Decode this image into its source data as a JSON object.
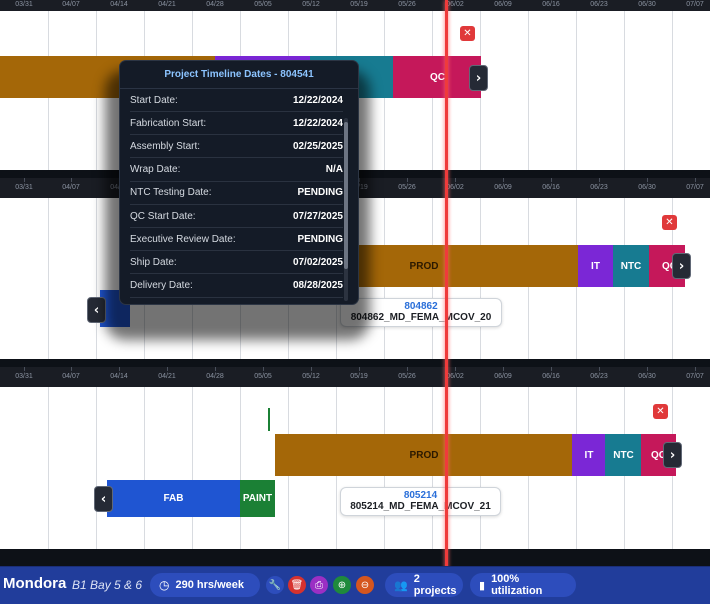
{
  "ruler": {
    "dates": [
      "03/31",
      "04/07",
      "04/14",
      "04/21",
      "04/28",
      "05/05",
      "05/12",
      "05/19",
      "05/26",
      "06/02",
      "06/09",
      "06/16",
      "06/23",
      "06/30",
      "07/07"
    ]
  },
  "rows": [
    {
      "qc_label": "QC",
      "close_icon": "close-icon",
      "next_icon": "chevron-right-icon"
    },
    {
      "prod_label": "PROD",
      "it_label": "IT",
      "ntc_label": "NTC",
      "qc_label": "QC",
      "project_number": "804862",
      "project_name": "804862_MD_FEMA_MCOV_20"
    },
    {
      "prod_label": "PROD",
      "it_label": "IT",
      "ntc_label": "NTC",
      "qc_label": "QC",
      "fab_label": "FAB",
      "paint_label": "PAINT",
      "project_number": "805214",
      "project_name": "805214_MD_FEMA_MCOV_21"
    }
  ],
  "tooltip": {
    "title": "Project Timeline Dates - 804541",
    "rows": [
      {
        "label": "Start Date:",
        "value": "12/22/2024"
      },
      {
        "label": "Fabrication Start:",
        "value": "12/22/2024"
      },
      {
        "label": "Assembly Start:",
        "value": "02/25/2025"
      },
      {
        "label": "Wrap Date:",
        "value": "N/A"
      },
      {
        "label": "NTC Testing Date:",
        "value": "PENDING"
      },
      {
        "label": "QC Start Date:",
        "value": "07/27/2025"
      },
      {
        "label": "Executive Review Date:",
        "value": "PENDING"
      },
      {
        "label": "Ship Date:",
        "value": "07/02/2025"
      },
      {
        "label": "Delivery Date:",
        "value": "08/28/2025"
      }
    ]
  },
  "toolbar": {
    "brand": "Mondora",
    "bay": "B1 Bay 5 & 6",
    "hours": "290 hrs/week",
    "projects": "2 projects",
    "utilization": "100% utilization",
    "icons": [
      "clock-icon",
      "wrench-icon",
      "trash-icon",
      "print-icon",
      "plus-icon",
      "minus-icon",
      "users-icon",
      "bar-chart-icon"
    ]
  },
  "colors": {
    "prod": "#a46708",
    "it": "#7b27d6",
    "ntc": "#177b91",
    "qc": "#c5185a",
    "fab": "#1f55d2",
    "paint": "#1b8035",
    "today_line": "#ef3b3b",
    "toolbar": "#213d9b"
  }
}
